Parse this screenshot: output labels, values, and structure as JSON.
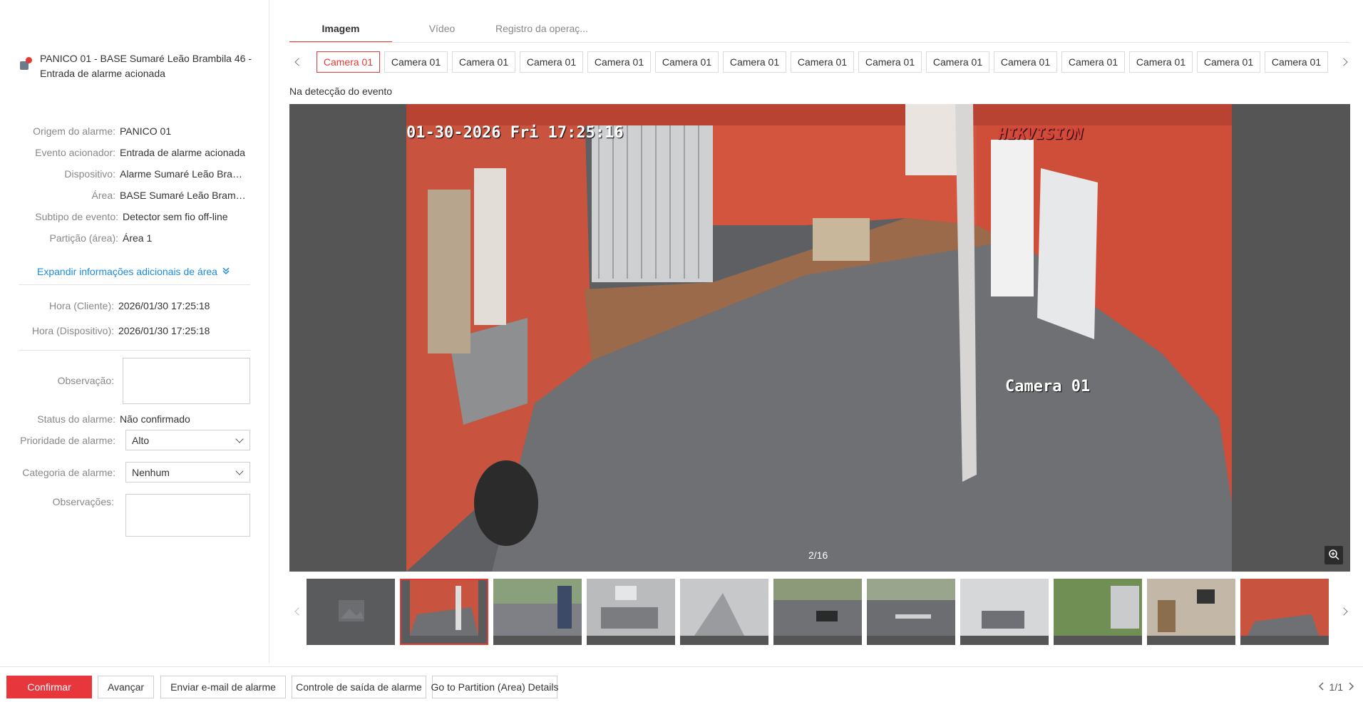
{
  "alarm": {
    "title": "PANICO 01 - BASE Sumaré Leão Brambila 46 - Entrada de alarme acionada"
  },
  "details": [
    {
      "label": "Origem do alarme:",
      "value": "PANICO 01"
    },
    {
      "label": "Evento acionador:",
      "value": "Entrada de alarme acionada"
    },
    {
      "label": "Dispositivo:",
      "value": "Alarme Sumaré Leão Bram..."
    },
    {
      "label": "Área:",
      "value": "BASE Sumaré Leão Brambil..."
    },
    {
      "label": "Subtipo de evento:",
      "value": "Detector sem fio off-line"
    },
    {
      "label": "Partição (área):",
      "value": "Área 1"
    }
  ],
  "expand_link": "Expandir informações adicionais de área",
  "times": [
    {
      "label": "Hora (Cliente):",
      "value": "2026/01/30 17:25:18"
    },
    {
      "label": "Hora (Dispositivo):",
      "value": "2026/01/30 17:25:18"
    }
  ],
  "form": {
    "observacao_label": "Observação:",
    "status_label": "Status do alarme:",
    "status_value": "Não confirmado",
    "priority_label": "Prioridade de alarme:",
    "priority_value": "Alto",
    "category_label": "Categoria de alarme:",
    "category_value": "Nenhum",
    "observacoes_label": "Observações:"
  },
  "tabs": [
    "Imagem",
    "Vídeo",
    "Registro da operaç..."
  ],
  "camera_tabs": [
    "Camera 01",
    "Camera 01",
    "Camera 01",
    "Camera 01",
    "Camera 01",
    "Camera 01",
    "Camera 01",
    "Camera 01",
    "Camera 01",
    "Camera 01",
    "Camera 01",
    "Camera 01",
    "Camera 01",
    "Camera 01",
    "Camera 01"
  ],
  "event_caption": "Na detecção do evento",
  "viewer": {
    "osd_datetime": "01-30-2026 Fri 17:25:16",
    "osd_brand": "HIKVISION",
    "osd_camera": "Camera 01",
    "counter": "2/16"
  },
  "buttons": {
    "confirm": "Confirmar",
    "advance": "Avançar",
    "email": "Enviar e-mail de alarme",
    "output": "Controle de saída de alarme",
    "partition": "Go to Partition (Area) Details"
  },
  "pager": "1/1",
  "colors": {
    "accent": "#e53935",
    "link": "#1a8ce0",
    "primary_button": "#e8363d"
  }
}
